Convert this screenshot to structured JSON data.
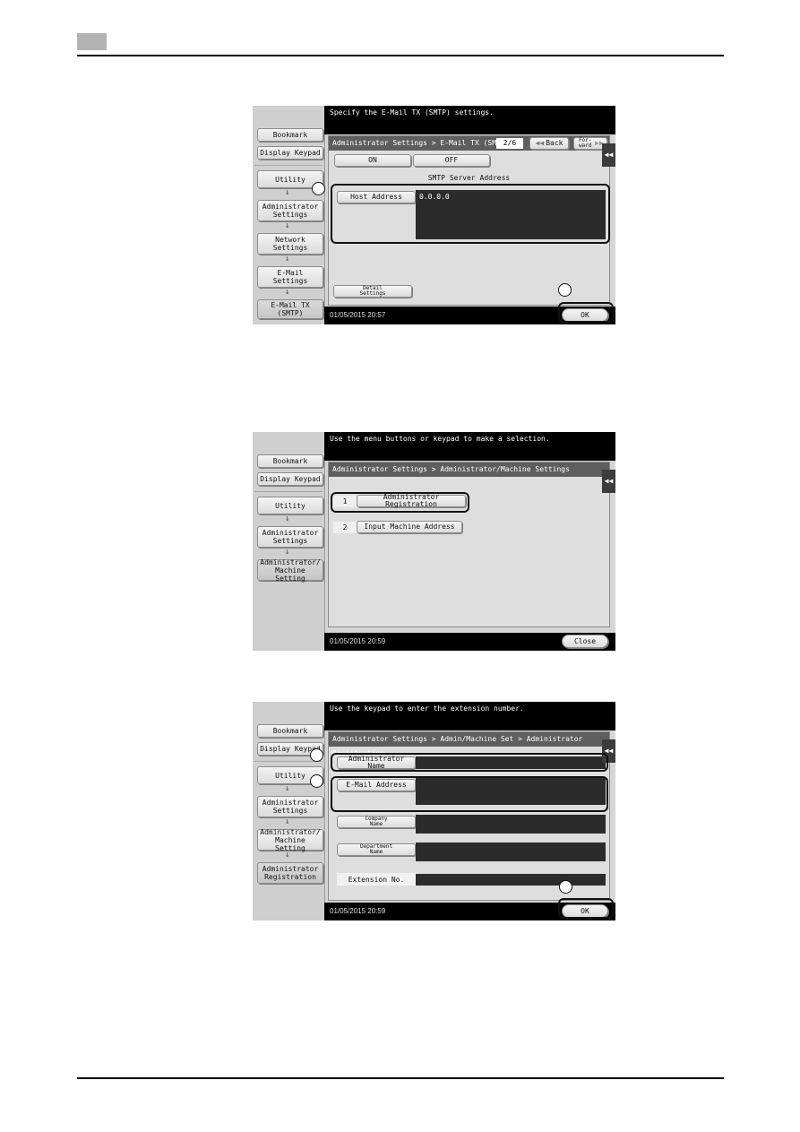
{
  "page": {
    "chapter_tab_color": "#b3b3b3"
  },
  "screens": [
    {
      "message": "Specify the E-Mail TX (SMTP) settings.",
      "sidebar": {
        "bookmark": "Bookmark",
        "display_keypad": "Display Keypad",
        "path": [
          "Utility",
          "Administrator Settings",
          "Network Settings",
          "E-Mail Settings",
          "E-Mail TX (SMTP)"
        ],
        "arrow": "↓"
      },
      "breadcrumb": "Administrator Settings > E-Mail TX (SMTP)",
      "page_indicator": "2/6",
      "back_label": "Back",
      "forward_label": "For- ward",
      "toggle": {
        "on": "ON",
        "off": "OFF"
      },
      "section_title": "SMTP Server Address",
      "host_address_label": "Host Address",
      "host_address_value": "0.0.0.0",
      "detail_settings_label": "Detail Settings",
      "ok_label": "OK",
      "status": "01/05/2015   20:57",
      "side_tab": "◀◀"
    },
    {
      "message": "Use the menu buttons or keypad to make a selection.",
      "sidebar": {
        "bookmark": "Bookmark",
        "display_keypad": "Display Keypad",
        "path": [
          "Utility",
          "Administrator Settings",
          "Administrator/ Machine Setting"
        ],
        "arrow": "↓"
      },
      "breadcrumb": "Administrator Settings > Administrator/Machine Settings",
      "menu": [
        {
          "num": "1",
          "label": "Administrator Registration"
        },
        {
          "num": "2",
          "label": "Input Machine Address"
        }
      ],
      "close_label": "Close",
      "status": "01/05/2015   20:59",
      "side_tab": "◀◀"
    },
    {
      "message": "Use the keypad to enter the extension number.",
      "sidebar": {
        "bookmark": "Bookmark",
        "display_keypad": "Display Keypad",
        "path": [
          "Utility",
          "Administrator Settings",
          "Administrator/ Machine Setting",
          "Administrator Registration"
        ],
        "arrow": "↓"
      },
      "breadcrumb": "Administrator Settings > Admin/Machine Set > Administrator Registration",
      "fields": {
        "admin_name": "Administrator Name",
        "email": "E-Mail Address",
        "company": "Company Name",
        "department": "Department Name",
        "extension": "Extension No."
      },
      "ok_label": "OK",
      "status": "01/05/2015   20:59",
      "side_tab": "◀◀"
    }
  ]
}
